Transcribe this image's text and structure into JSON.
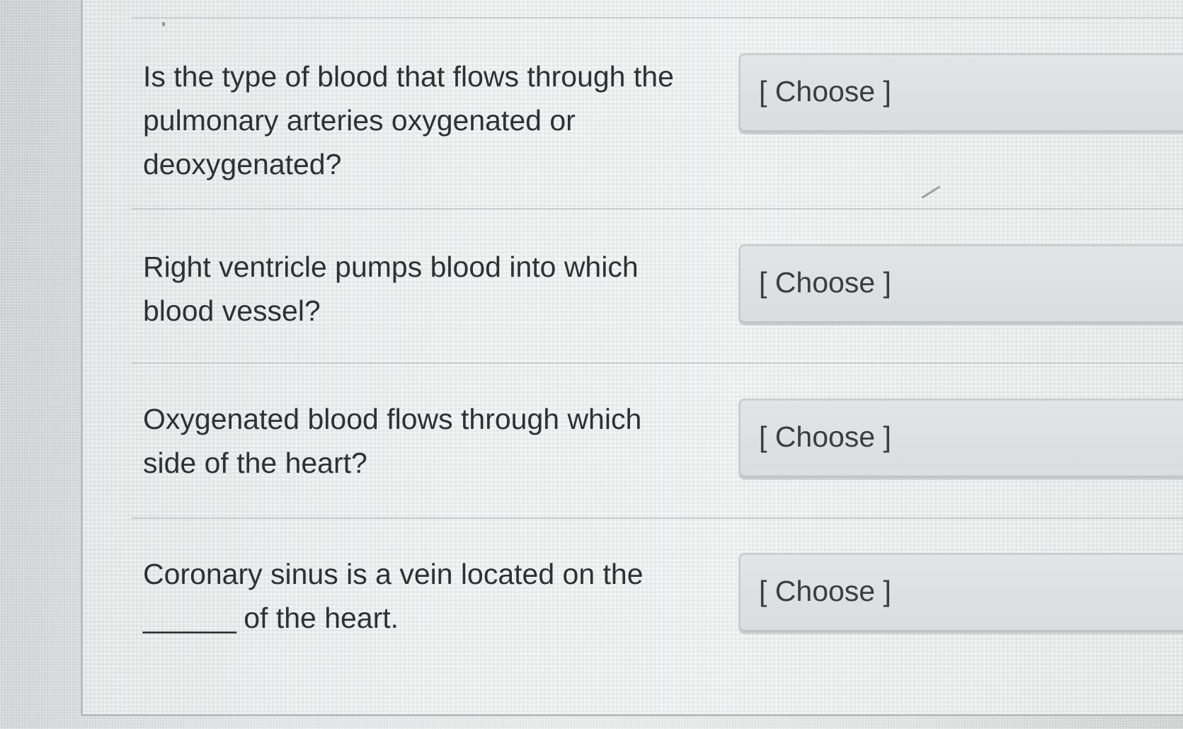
{
  "questions": [
    {
      "text": "Is the type of blood that flows through the\npulmonary arteries oxygenated or\ndeoxygenated?",
      "dropdown_value": "[ Choose ]"
    },
    {
      "text": "Right ventricle pumps blood into which\nblood vessel?",
      "dropdown_value": "[ Choose ]"
    },
    {
      "text": "Oxygenated blood flows through which\nside of the heart?",
      "dropdown_value": "[ Choose ]"
    },
    {
      "text_line1": "Coronary sinus is a vein located on the",
      "blank": "______",
      "text_line2_rest": " of the heart.",
      "dropdown_value": "[ Choose ]"
    }
  ]
}
